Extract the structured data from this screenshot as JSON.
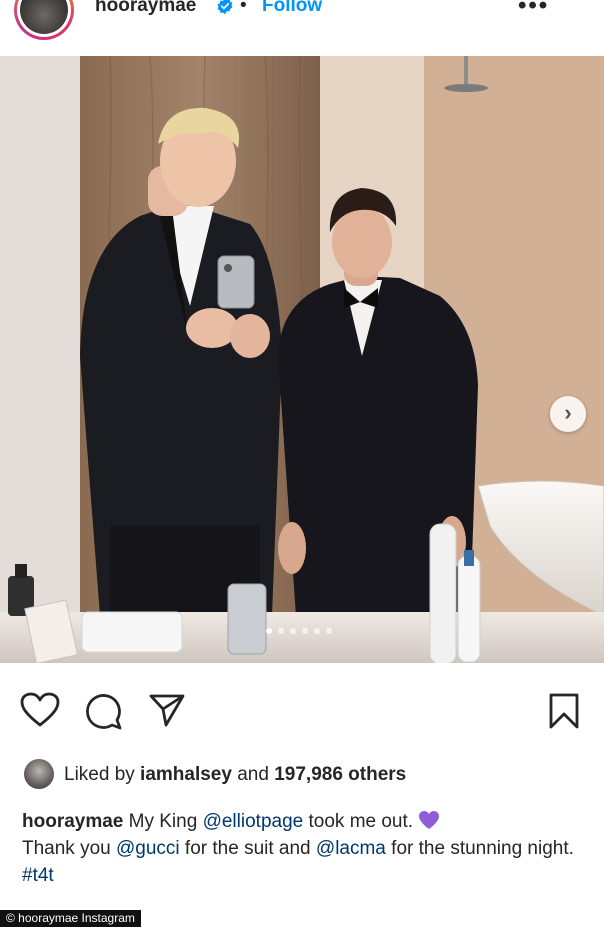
{
  "header": {
    "username": "hooraymae",
    "separator": "•",
    "follow_label": "Follow",
    "more_label": "•••"
  },
  "post": {
    "image_description_icons": [
      "next-arrow-icon"
    ],
    "next_label": "›",
    "carousel_count": 6,
    "carousel_active": 0
  },
  "actions": {
    "icons": [
      "heart-icon",
      "comment-icon",
      "share-icon",
      "bookmark-icon"
    ]
  },
  "likes": {
    "prefix": "Liked by ",
    "user": "iamhalsey",
    "middle": " and ",
    "count": "197,986 others"
  },
  "caption": {
    "user": "hooraymae",
    "text1": " My King ",
    "mention1": "@elliotpage",
    "text2": " took me out. ",
    "text3": "Thank you ",
    "mention2": "@gucci",
    "text4": " for the suit and ",
    "mention3": "@lacma",
    "text5": " for the stunning night.",
    "hashtag": "#t4t"
  },
  "credit": {
    "label": "© hooraymae Instagram"
  },
  "colors": {
    "link": "#0095f6",
    "mention": "#00376b",
    "verified": "#0095f6",
    "purple_heart": "#8e5fd8"
  }
}
